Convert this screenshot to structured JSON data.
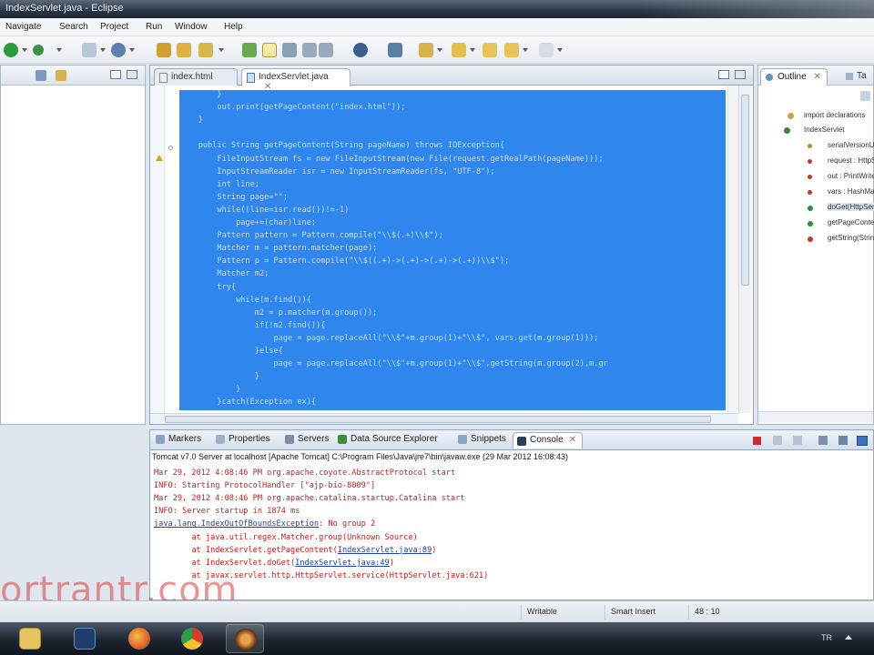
{
  "window": {
    "title": "IndexServlet.java - Eclipse"
  },
  "menu": [
    "Navigate",
    "Search",
    "Project",
    "Run",
    "Window",
    "Help"
  ],
  "editor": {
    "tabs": [
      {
        "label": "index.html"
      },
      {
        "label": "IndexServlet.java"
      }
    ],
    "code_lines": [
      "        }",
      "        out.print(getPageContent(\"index.html\"));",
      "    }",
      "",
      "    public String getPageContent(String pageName) throws IOException{",
      "        FileInputStream fs = new FileInputStream(new File(request.getRealPath(pageName)));",
      "        InputStreamReader isr = new InputStreamReader(fs, \"UTF-8\");",
      "        int line;",
      "        String page=\"\";",
      "        while((line=isr.read())!=-1)",
      "            page+=(char)line;",
      "        Pattern pattern = Pattern.compile(\"\\\\$(.+)\\\\$\");",
      "        Matcher m = pattern.matcher(page);",
      "        Pattern p = Pattern.compile(\"\\\\$((.+)->(.+)->(.+)->(.+))\\\\$\");",
      "        Matcher m2;",
      "        try{",
      "            while(m.find()){",
      "                m2 = p.matcher(m.group());",
      "                if(!m2.find()){",
      "                    page = page.replaceAll(\"\\\\$\"+m.group(1)+\"\\\\$\", vars.get(m.group(1)));",
      "                }else{",
      "                    page = page.replaceAll(\"\\\\$\"+m.group(1)+\"\\\\$\",getString(m.group(2),m.gr",
      "                }",
      "            }",
      "        }catch(Exception ex){"
    ]
  },
  "outline": {
    "tab_label": "Outline",
    "tab2_label": "Ta",
    "items": [
      "import declarations",
      "IndexServlet",
      "serialVersionUID",
      "request : HttpServletRequest",
      "out : PrintWriter",
      "vars : HashMap",
      "doGet(HttpServletRequest, HttpServletResponse)",
      "getPageContent(String)",
      "getString(String)"
    ]
  },
  "bottom": {
    "tabs": [
      "Markers",
      "Properties",
      "Servers",
      "Data Source Explorer",
      "Snippets",
      "Console"
    ],
    "console_header": "Tomcat v7.0 Server at localhost [Apache Tomcat] C:\\Program Files\\Java\\jre7\\bin\\javaw.exe (29 Mar 2012 16:08:43)",
    "lines": [
      {
        "text": "Mar 29, 2012 4:08:46 PM org.apache.coyote.AbstractProtocol start",
        "style": "red"
      },
      {
        "text": "INFO: Starting ProtocolHandler [\"ajp-bio-8009\"]",
        "style": "red"
      },
      {
        "text": "Mar 29, 2012 4:08:46 PM org.apache.catalina.startup.Catalina start",
        "style": "red"
      },
      {
        "text": "INFO: Server startup in 1874 ms",
        "style": "red"
      },
      {
        "text": "java.lang.IndexOutOfBoundsException",
        "suffix": ": No group 2",
        "style": "exception"
      },
      {
        "text": "        at java.util.regex.Matcher.group(Unknown Source)",
        "style": "red"
      },
      {
        "text": "        at IndexServlet.getPageContent(",
        "link": "IndexServlet.java:89",
        "suffix": ")",
        "style": "trace"
      },
      {
        "text": "        at IndexServlet.doGet(",
        "link": "IndexServlet.java:49",
        "suffix": ")",
        "style": "trace"
      },
      {
        "text": "        at javax.servlet.http.HttpServlet.service(HttpServlet.java:621)",
        "style": "red"
      }
    ]
  },
  "status": {
    "writable": "Writable",
    "insert_mode": "Smart Insert",
    "position": "48 : 10"
  },
  "watermark": "ortrantr.com",
  "taskbar": {
    "apps": [
      "file-explorer",
      "photoshop",
      "firefox",
      "chrome",
      "eclipse"
    ],
    "tray_lang": "TR"
  },
  "colors": {
    "selection": "#2f86ec",
    "console_error": "#c81e1e",
    "link": "#1f3fb3"
  }
}
